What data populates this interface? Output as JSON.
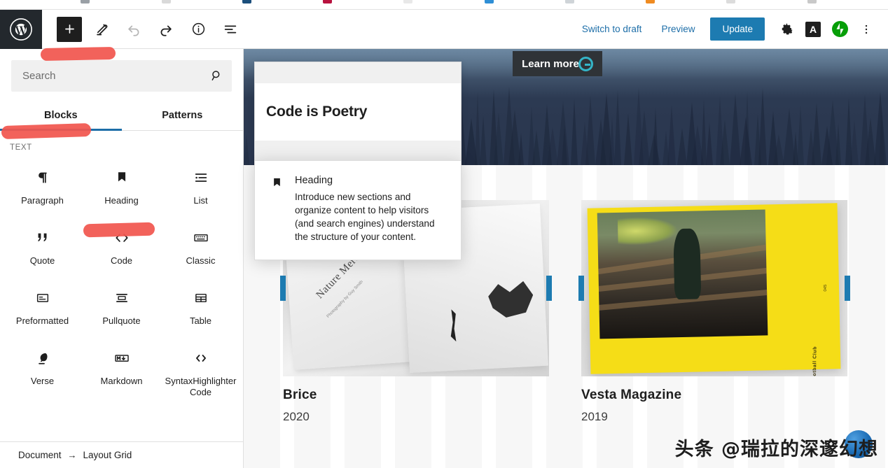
{
  "browser": {
    "favicon_colors": [
      "#9aa0a6",
      "#d9d9d9",
      "#1c4f7c",
      "#b8123f",
      "#e8e8e8",
      "#2f8fd6",
      "#cfd4d8",
      "#ef8b21",
      "#dcdcdc",
      "#c9c9c9"
    ]
  },
  "header": {
    "logo_icon": "wordpress-logo-icon",
    "tools": [
      {
        "name": "add-block-button",
        "icon": "plus-icon",
        "state": "primary"
      },
      {
        "name": "edit-tool-button",
        "icon": "pencil-icon",
        "state": "default"
      },
      {
        "name": "undo-button",
        "icon": "undo-arrow-icon",
        "state": "disabled"
      },
      {
        "name": "redo-button",
        "icon": "redo-arrow-icon",
        "state": "default"
      },
      {
        "name": "details-button",
        "icon": "info-circle-icon",
        "state": "default"
      },
      {
        "name": "list-view-button",
        "icon": "list-view-icon",
        "state": "default"
      }
    ],
    "switch_to_draft_label": "Switch to draft",
    "preview_label": "Preview",
    "update_label": "Update",
    "settings_icon": "gear-icon",
    "letter_badge": "A",
    "jetpack_icon": "jetpack-icon",
    "more_options_icon": "vertical-ellipsis-icon",
    "accent_blue": "#1d7bb1",
    "link_blue": "#1d6ea8",
    "jetpack_green": "#069e08"
  },
  "inserter": {
    "search": {
      "placeholder": "Search",
      "value": "",
      "icon": "search-icon"
    },
    "tabs": [
      {
        "label": "Blocks",
        "active": true
      },
      {
        "label": "Patterns",
        "active": false
      }
    ],
    "section_label": "TEXT",
    "blocks": [
      {
        "label": "Paragraph",
        "icon": "pilcrow-icon"
      },
      {
        "label": "Heading",
        "icon": "bookmark-icon"
      },
      {
        "label": "List",
        "icon": "list-icon"
      },
      {
        "label": "Quote",
        "icon": "quote-marks-icon"
      },
      {
        "label": "Code",
        "icon": "angle-brackets-icon"
      },
      {
        "label": "Classic",
        "icon": "keyboard-icon"
      },
      {
        "label": "Preformatted",
        "icon": "preformatted-icon"
      },
      {
        "label": "Pullquote",
        "icon": "pullquote-icon"
      },
      {
        "label": "Table",
        "icon": "table-grid-icon"
      },
      {
        "label": "Verse",
        "icon": "feather-pen-icon"
      },
      {
        "label": "Markdown",
        "icon": "markdown-icon"
      },
      {
        "label": "SyntaxHighlighter Code",
        "icon": "angle-brackets-icon"
      }
    ],
    "breadcrumb": {
      "root": "Document",
      "arrow": "→",
      "current": "Layout Grid"
    }
  },
  "block_popover": {
    "icon": "bookmark-icon",
    "title": "Heading",
    "description": "Introduce new sections and organize content to help visitors (and search engines) understand the structure of your content."
  },
  "preview_float": {
    "title": "Code is Poetry"
  },
  "canvas": {
    "hero": {
      "banner_label": "Learn more",
      "banner_icon": "g-circle-icon"
    },
    "cards": [
      {
        "title": "Brice",
        "year": "2020",
        "image_name": "open-book-nature-merchant-photo",
        "image_caption_title": "Nature Merchant",
        "image_caption_sub": "Photography by Guy Smith"
      },
      {
        "title": "Vesta Magazine",
        "year": "2019",
        "image_name": "yellow-magazine-spread-photo",
        "image_caption_title": "Jojo Football Club",
        "image_page_number": "045"
      }
    ]
  },
  "annotations": {
    "marker_color": "#f1564f",
    "count": 3
  },
  "watermark": {
    "text": "头条 @瑞拉的深邃幻想"
  },
  "fab": {
    "name": "scroll-to-top-button"
  }
}
